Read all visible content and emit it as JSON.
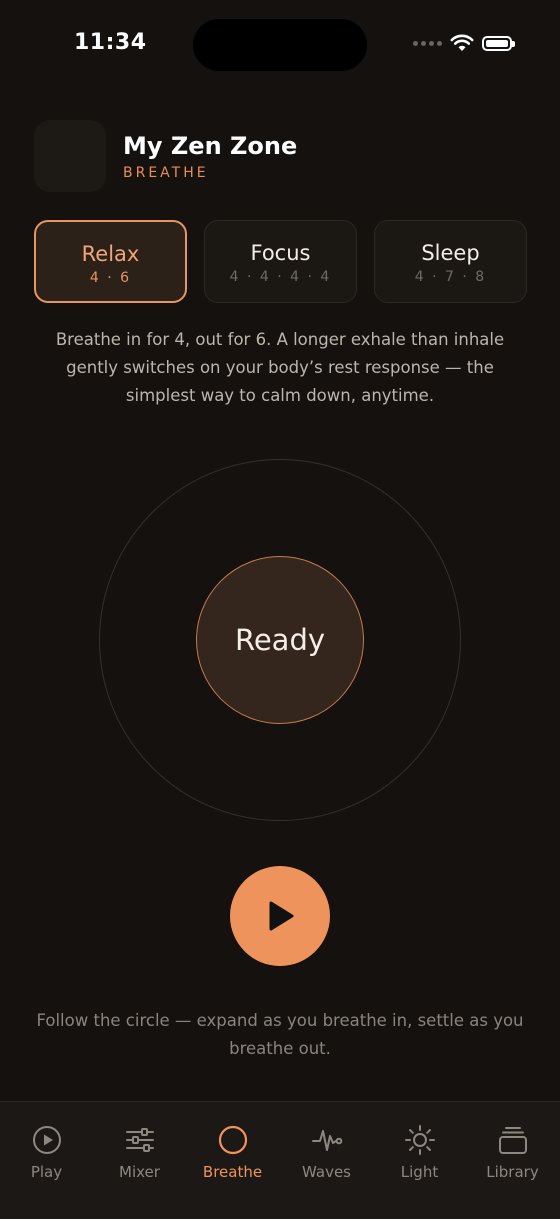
{
  "status_bar": {
    "time": "11:34"
  },
  "header": {
    "title": "My Zen Zone",
    "subtitle": "BREATHE"
  },
  "presets": [
    {
      "name": "Relax",
      "pattern": "4 · 6",
      "selected": true
    },
    {
      "name": "Focus",
      "pattern": "4 · 4 · 4 · 4",
      "selected": false
    },
    {
      "name": "Sleep",
      "pattern": "4 · 7 · 8",
      "selected": false
    }
  ],
  "description": "Breathe in for 4, out for 6. A longer exhale than inhale gently switches on your body’s rest response — the simplest way to calm down, anytime.",
  "breath": {
    "state": "Ready"
  },
  "hint": "Follow the circle — expand as you breathe in, settle as you breathe out.",
  "tabs": [
    {
      "label": "Play",
      "icon": "play-circle-icon"
    },
    {
      "label": "Mixer",
      "icon": "sliders-icon"
    },
    {
      "label": "Breathe",
      "icon": "circle-icon",
      "active": true
    },
    {
      "label": "Waves",
      "icon": "waveform-icon"
    },
    {
      "label": "Light",
      "icon": "sun-icon"
    },
    {
      "label": "Library",
      "icon": "stack-icon"
    }
  ],
  "colors": {
    "accent": "#ee935c",
    "background": "#14110e",
    "card": "#1b1814"
  }
}
